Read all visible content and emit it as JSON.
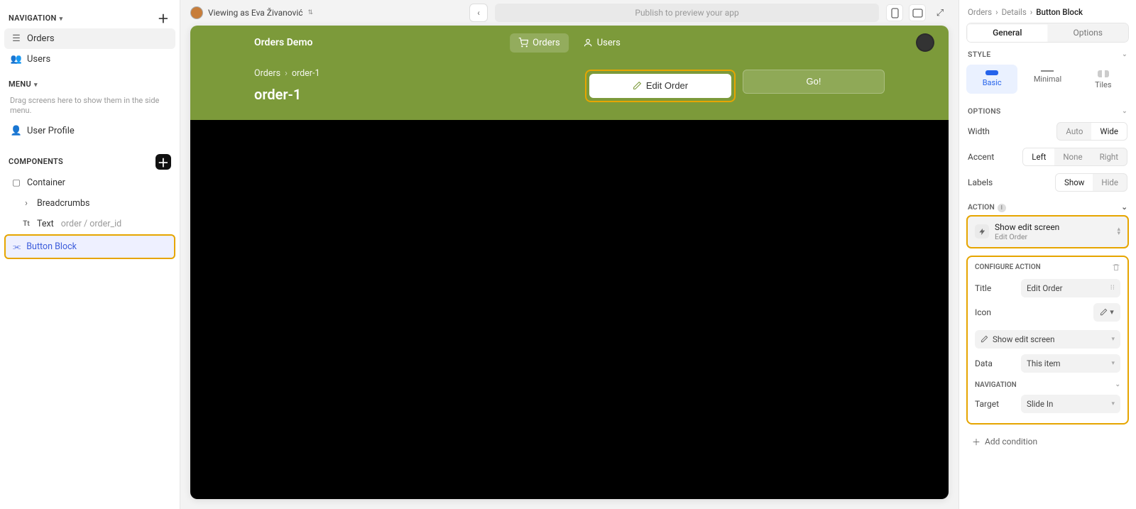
{
  "left": {
    "nav_header": "NAVIGATION",
    "items": [
      {
        "label": "Orders",
        "active": true
      },
      {
        "label": "Users",
        "active": false
      }
    ],
    "menu_header": "MENU",
    "menu_hint": "Drag screens here to show them in the side menu.",
    "menu_items": [
      {
        "label": "User Profile"
      }
    ],
    "components_header": "COMPONENTS",
    "components": {
      "container": "Container",
      "breadcrumbs": "Breadcrumbs",
      "text_label": "Text",
      "text_binding": "order / order_id",
      "button_block": "Button Block"
    }
  },
  "toolbar": {
    "viewing_as": "Viewing as Eva Živanović",
    "publish_hint": "Publish to preview your app"
  },
  "app": {
    "title": "Orders Demo",
    "tabs": {
      "orders": "Orders",
      "users": "Users"
    },
    "crumb_root": "Orders",
    "crumb_current": "order-1",
    "page_title": "order-1",
    "buttons": {
      "edit": "Edit Order",
      "go": "Go!"
    }
  },
  "right": {
    "crumbs": {
      "a": "Orders",
      "b": "Details",
      "c": "Button Block"
    },
    "tabs": {
      "general": "General",
      "options": "Options"
    },
    "style_header": "STYLE",
    "styles": {
      "basic": "Basic",
      "minimal": "Minimal",
      "tiles": "Tiles"
    },
    "options_header": "OPTIONS",
    "options": {
      "width_label": "Width",
      "width_auto": "Auto",
      "width_wide": "Wide",
      "accent_label": "Accent",
      "accent_left": "Left",
      "accent_none": "None",
      "accent_right": "Right",
      "labels_label": "Labels",
      "labels_show": "Show",
      "labels_hide": "Hide"
    },
    "action_header": "ACTION",
    "action_card": {
      "title": "Show edit screen",
      "subtitle": "Edit Order"
    },
    "config_header": "CONFIGURE ACTION",
    "config": {
      "title_label": "Title",
      "title_value": "Edit Order",
      "icon_label": "Icon",
      "action_type": "Show edit screen",
      "data_label": "Data",
      "data_value": "This item",
      "nav_header": "NAVIGATION",
      "target_label": "Target",
      "target_value": "Slide In"
    },
    "add_condition": "Add condition"
  }
}
